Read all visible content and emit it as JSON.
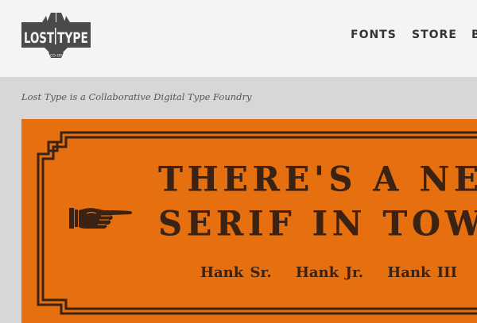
{
  "logo": {
    "line1_left": "LOST",
    "line1_right": "TYPE",
    "line2": "CO-OP"
  },
  "nav": {
    "items": [
      {
        "label": "FONTS"
      },
      {
        "label": "STORE"
      },
      {
        "label": "B"
      }
    ]
  },
  "tagline": "Lost Type is a Collaborative Digital Type Foundry",
  "banner": {
    "headline_line1": "THERE'S A NEW",
    "headline_line2": "SERIF IN TOWN",
    "families": [
      "Hank Sr.",
      "Hank Jr.",
      "Hank III"
    ],
    "background_color": "#e6700f",
    "ink_color": "#3b2212",
    "icon": "pointing-hand-icon"
  }
}
